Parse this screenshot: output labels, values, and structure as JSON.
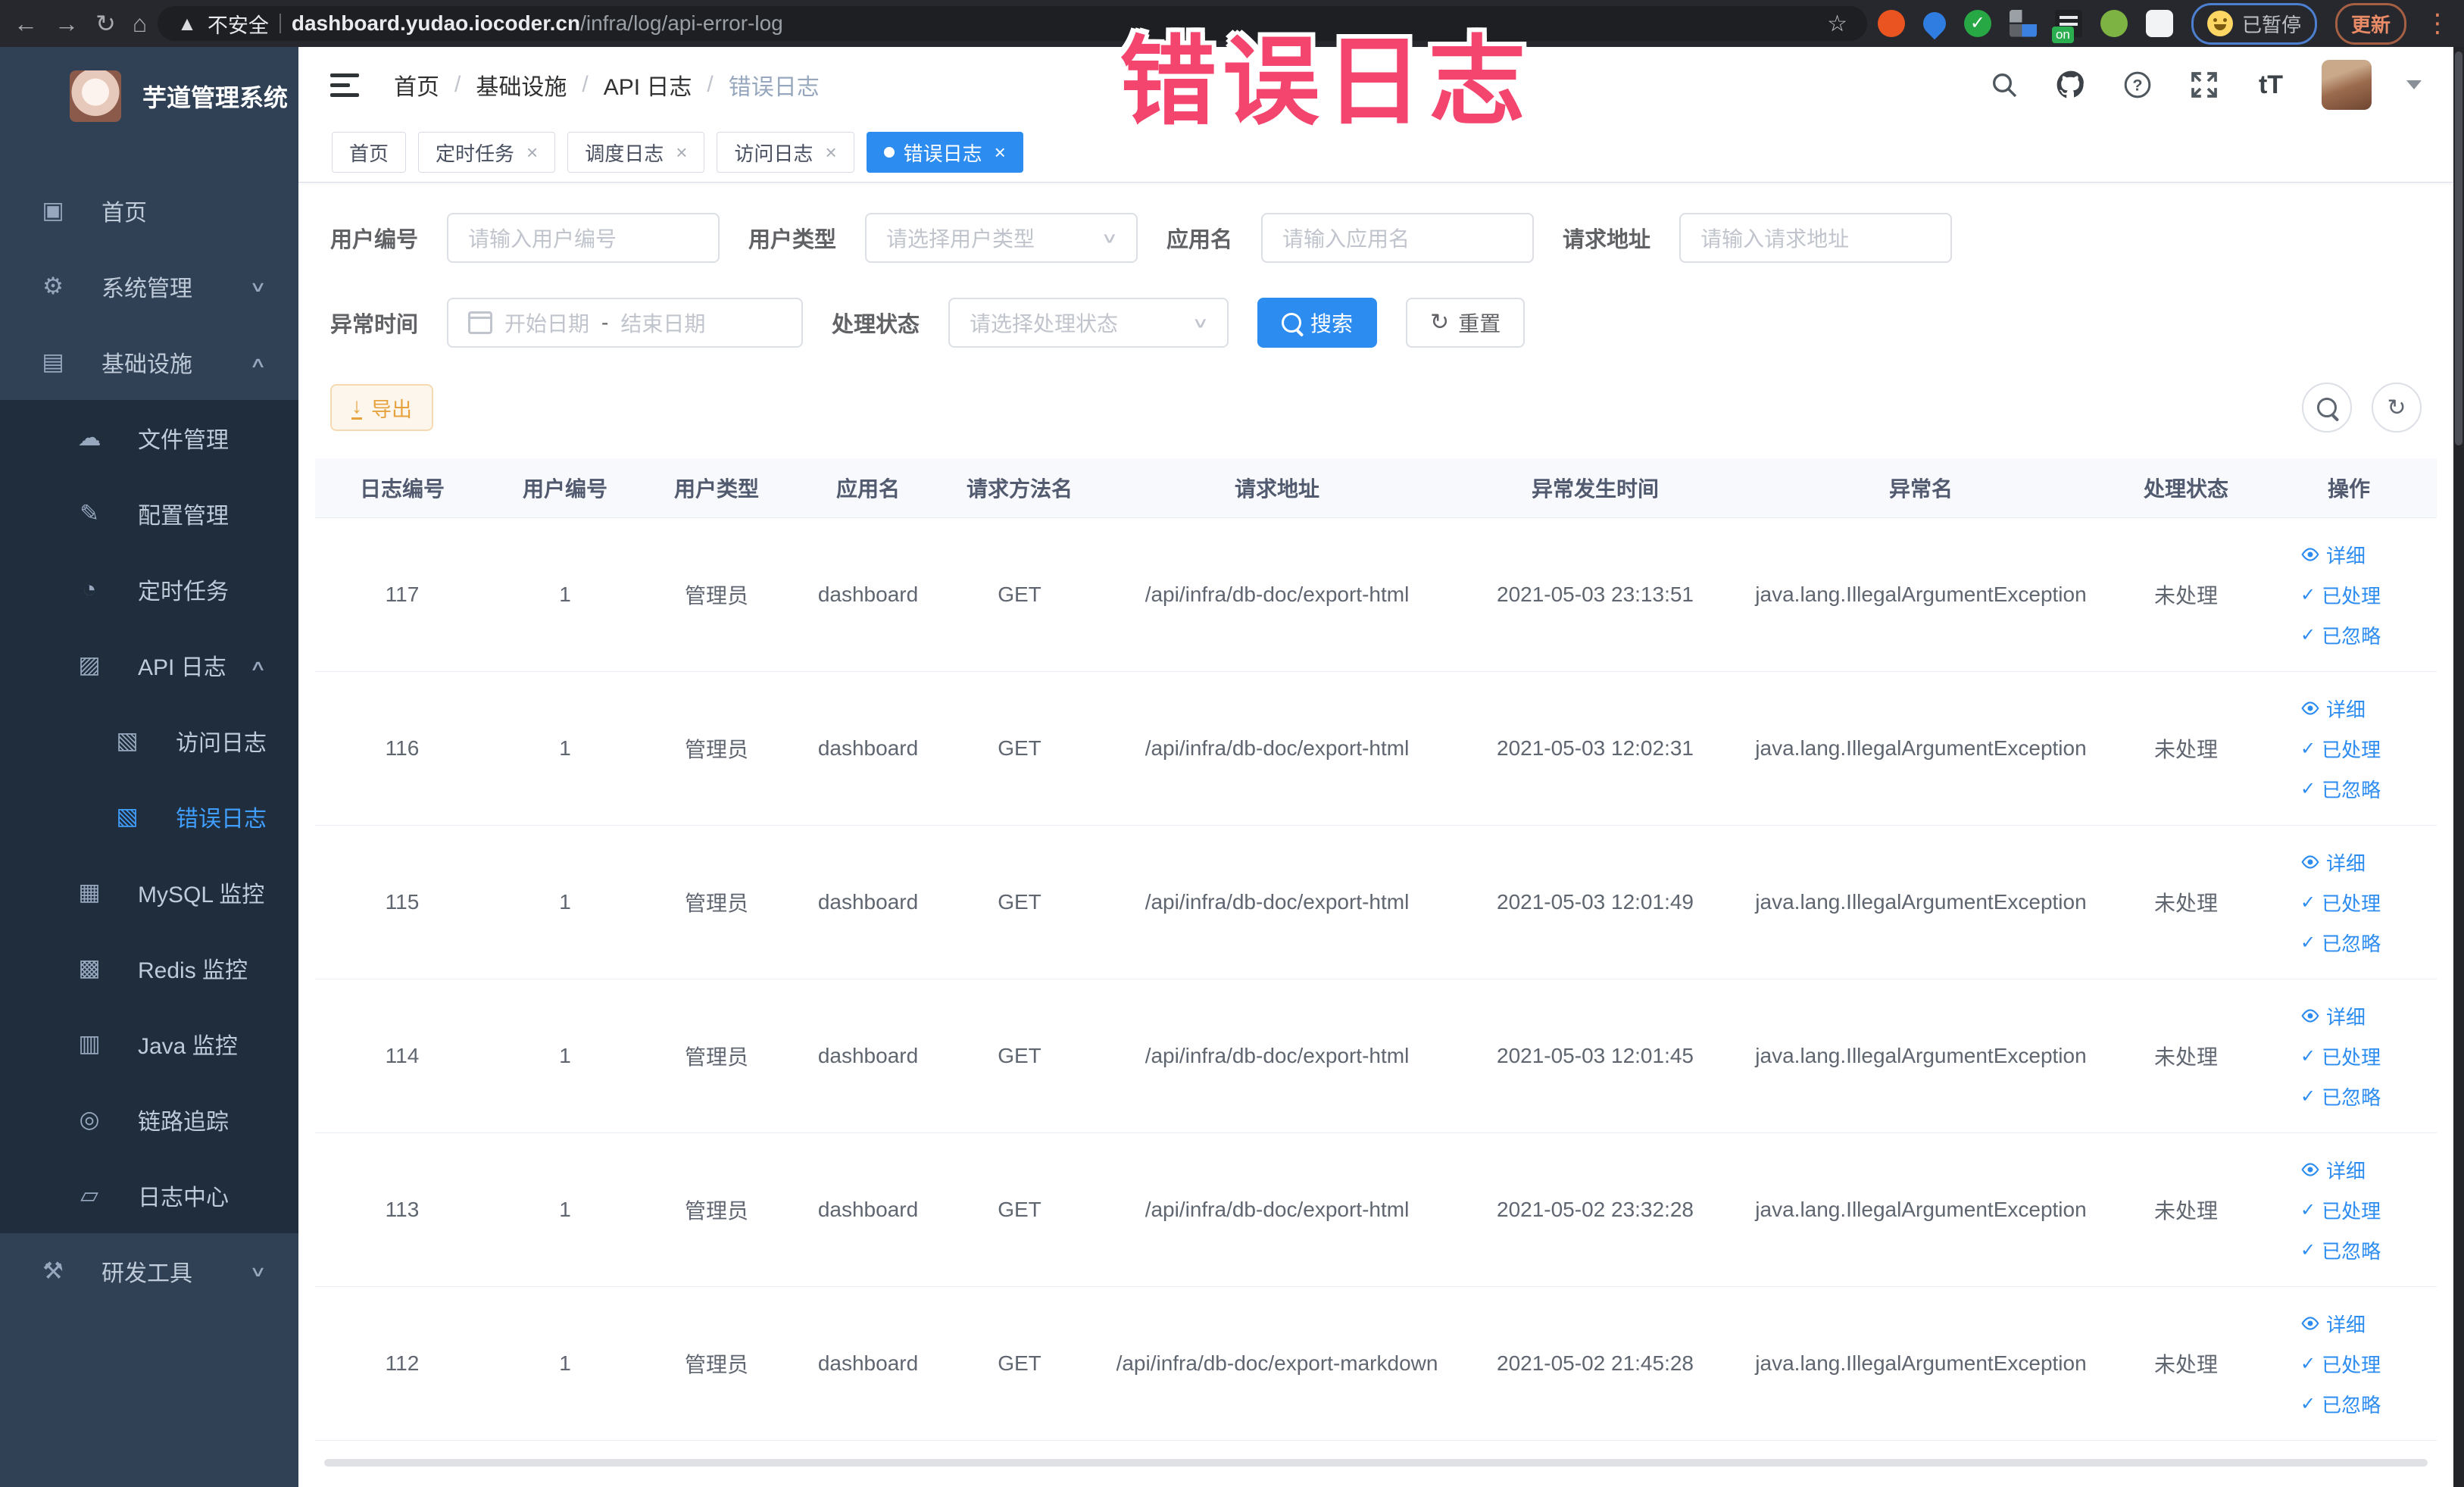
{
  "colors": {
    "accent": "#2d8cf0",
    "sidebar_bg": "#304156",
    "sidebar_section_bg": "#1f2d3d",
    "active_menu": "#409eff",
    "warning": "#e6a23c",
    "annotation": "#f3456e"
  },
  "browser": {
    "security_label": "不安全",
    "url_host": "dashboard.yudao.iocoder.cn",
    "url_path": "/infra/log/api-error-log",
    "extension_on_badge": "on",
    "paused_badge_label": "已暂停",
    "update_button_label": "更新"
  },
  "annotation": {
    "text": "错误日志"
  },
  "sidebar": {
    "title": "芋道管理系统",
    "items": [
      {
        "label": "首页",
        "icon": "dashboard-icon",
        "glyph": "▣",
        "level": 1
      },
      {
        "label": "系统管理",
        "icon": "gear-icon",
        "glyph": "⚙",
        "level": 1,
        "chevron": "down"
      },
      {
        "label": "基础设施",
        "icon": "infrastructure-icon",
        "glyph": "▤",
        "level": 1,
        "chevron": "up"
      },
      {
        "label": "文件管理",
        "icon": "cloud-upload-icon",
        "glyph": "☁",
        "level": 2,
        "section": true
      },
      {
        "label": "配置管理",
        "icon": "edit-icon",
        "glyph": "✎",
        "level": 2,
        "section": true
      },
      {
        "label": "定时任务",
        "icon": "timer-icon",
        "glyph": "◔",
        "level": 2,
        "section": true
      },
      {
        "label": "API 日志",
        "icon": "api-log-icon",
        "glyph": "▨",
        "level": 2,
        "section": true,
        "chevron": "up"
      },
      {
        "label": "访问日志",
        "icon": "access-log-icon",
        "glyph": "▧",
        "level": 3,
        "section": true
      },
      {
        "label": "错误日志",
        "icon": "error-log-icon",
        "glyph": "▧",
        "level": 3,
        "section": true,
        "active": true
      },
      {
        "label": "MySQL 监控",
        "icon": "mysql-monitor-icon",
        "glyph": "▦",
        "level": 2,
        "section": true
      },
      {
        "label": "Redis 监控",
        "icon": "redis-monitor-icon",
        "glyph": "▩",
        "level": 2,
        "section": true
      },
      {
        "label": "Java 监控",
        "icon": "java-monitor-icon",
        "glyph": "▥",
        "level": 2,
        "section": true
      },
      {
        "label": "链路追踪",
        "icon": "trace-eye-icon",
        "glyph": "◎",
        "level": 2,
        "section": true
      },
      {
        "label": "日志中心",
        "icon": "log-center-icon",
        "glyph": "▱",
        "level": 2,
        "section": true
      },
      {
        "label": "研发工具",
        "icon": "dev-tools-icon",
        "glyph": "⚒",
        "level": 1,
        "chevron": "down"
      }
    ]
  },
  "breadcrumb": {
    "items": [
      {
        "label": "首页",
        "muted": false
      },
      {
        "label": "基础设施",
        "muted": false
      },
      {
        "label": "API 日志",
        "muted": false
      },
      {
        "label": "错误日志",
        "muted": true
      }
    ]
  },
  "tabs": {
    "items": [
      {
        "label": "首页",
        "closable": false,
        "active": false
      },
      {
        "label": "定时任务",
        "closable": true,
        "active": false
      },
      {
        "label": "调度日志",
        "closable": true,
        "active": false
      },
      {
        "label": "访问日志",
        "closable": true,
        "active": false
      },
      {
        "label": "错误日志",
        "closable": true,
        "active": true
      }
    ]
  },
  "filters": {
    "user_id": {
      "label": "用户编号",
      "placeholder": "请输入用户编号"
    },
    "user_type": {
      "label": "用户类型",
      "placeholder": "请选择用户类型"
    },
    "app_name": {
      "label": "应用名",
      "placeholder": "请输入应用名"
    },
    "request_url": {
      "label": "请求地址",
      "placeholder": "请输入请求地址"
    },
    "exception_time": {
      "label": "异常时间",
      "start_placeholder": "开始日期",
      "separator": "-",
      "end_placeholder": "结束日期"
    },
    "process_status": {
      "label": "处理状态",
      "placeholder": "请选择处理状态"
    },
    "search_button": "搜索",
    "reset_button": "重置"
  },
  "toolbar": {
    "export_label": "导出"
  },
  "table": {
    "columns": [
      "日志编号",
      "用户编号",
      "用户类型",
      "应用名",
      "请求方法名",
      "请求地址",
      "异常发生时间",
      "异常名",
      "处理状态",
      "操作"
    ],
    "actions": [
      "详细",
      "已处理",
      "已忽略"
    ],
    "rows": [
      {
        "id": "117",
        "user_id": "1",
        "user_type": "管理员",
        "app": "dashboard",
        "method": "GET",
        "url": "/api/infra/db-doc/export-html",
        "time": "2021-05-03 23:13:51",
        "exception": "java.lang.IllegalArgumentException",
        "status": "未处理"
      },
      {
        "id": "116",
        "user_id": "1",
        "user_type": "管理员",
        "app": "dashboard",
        "method": "GET",
        "url": "/api/infra/db-doc/export-html",
        "time": "2021-05-03 12:02:31",
        "exception": "java.lang.IllegalArgumentException",
        "status": "未处理"
      },
      {
        "id": "115",
        "user_id": "1",
        "user_type": "管理员",
        "app": "dashboard",
        "method": "GET",
        "url": "/api/infra/db-doc/export-html",
        "time": "2021-05-03 12:01:49",
        "exception": "java.lang.IllegalArgumentException",
        "status": "未处理"
      },
      {
        "id": "114",
        "user_id": "1",
        "user_type": "管理员",
        "app": "dashboard",
        "method": "GET",
        "url": "/api/infra/db-doc/export-html",
        "time": "2021-05-03 12:01:45",
        "exception": "java.lang.IllegalArgumentException",
        "status": "未处理"
      },
      {
        "id": "113",
        "user_id": "1",
        "user_type": "管理员",
        "app": "dashboard",
        "method": "GET",
        "url": "/api/infra/db-doc/export-html",
        "time": "2021-05-02 23:32:28",
        "exception": "java.lang.IllegalArgumentException",
        "status": "未处理"
      },
      {
        "id": "112",
        "user_id": "1",
        "user_type": "管理员",
        "app": "dashboard",
        "method": "GET",
        "url": "/api/infra/db-doc/export-markdown",
        "time": "2021-05-02 21:45:28",
        "exception": "java.lang.IllegalArgumentException",
        "status": "未处理"
      }
    ]
  }
}
